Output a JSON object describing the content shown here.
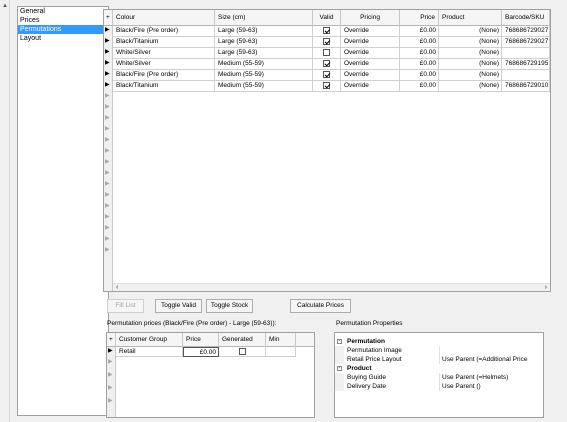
{
  "nav": {
    "items": [
      "General",
      "Prices",
      "Permutations",
      "Layout"
    ],
    "selected_index": 2
  },
  "grid": {
    "columns": [
      "Colour",
      "Size (cm)",
      "Valid",
      "Pricing",
      "Price",
      "Product",
      "Barcode/SKU"
    ],
    "rows": [
      {
        "colour": "Black/Fire (Pre order)",
        "size": "Large (59-63)",
        "valid": true,
        "pricing": "Override",
        "price": "£0.00",
        "product": "(None)",
        "barcode": "768686729027"
      },
      {
        "colour": "Black/Titanium",
        "size": "Large (59-63)",
        "valid": true,
        "pricing": "Override",
        "price": "£0.00",
        "product": "(None)",
        "barcode": "768686729027"
      },
      {
        "colour": "White/Silver",
        "size": "Large (59-63)",
        "valid": false,
        "pricing": "Override",
        "price": "£0.00",
        "product": "(None)",
        "barcode": ""
      },
      {
        "colour": "White/Silver",
        "size": "Medium (55-59)",
        "valid": true,
        "pricing": "Override",
        "price": "£0.00",
        "product": "(None)",
        "barcode": "768686729195"
      },
      {
        "colour": "Black/Fire (Pre order)",
        "size": "Medium (55-59)",
        "valid": true,
        "pricing": "Override",
        "price": "£0.00",
        "product": "(None)",
        "barcode": ""
      },
      {
        "colour": "Black/Titanium",
        "size": "Medium (55-59)",
        "valid": true,
        "pricing": "Override",
        "price": "£0.00",
        "product": "(None)",
        "barcode": "768686729010"
      }
    ],
    "empty_rows": 15
  },
  "buttons": {
    "fill_list": "Fill List",
    "toggle_valid": "Toggle Valid",
    "toggle_stock": "Toggle Stock",
    "calculate_prices": "Calculate Prices"
  },
  "perm_prices": {
    "label": "Permutation prices (Black/Fire (Pre order) - Large (59-63)):",
    "columns": [
      "Customer Group",
      "Price",
      "Generated",
      "Min"
    ],
    "rows": [
      {
        "group": "Retail",
        "price": "£0.00",
        "generated": false,
        "min": ""
      }
    ],
    "empty_rows": 4
  },
  "properties": {
    "label": "Permutation Properties",
    "categories": [
      {
        "name": "Permutation",
        "toggle": "-",
        "props": [
          {
            "name": "Permutation Image",
            "value": ""
          },
          {
            "name": "Retail Price Layout",
            "value": "Use Parent (=Additional Price"
          }
        ]
      },
      {
        "name": "Product",
        "toggle": "-",
        "props": [
          {
            "name": "Buying Guide",
            "value": "Use Parent (=Helmets)"
          },
          {
            "name": "Delivery Date",
            "value": "Use Parent ()"
          }
        ]
      }
    ]
  },
  "icons": {
    "row_marker": "triangle-right",
    "scroll_up": "caret-up",
    "scroll_left": "caret-left",
    "scroll_right": "caret-right"
  },
  "colors": {
    "selection": "#3399ff",
    "window_bg": "#f0f0f0",
    "border": "#a0a0a0"
  }
}
